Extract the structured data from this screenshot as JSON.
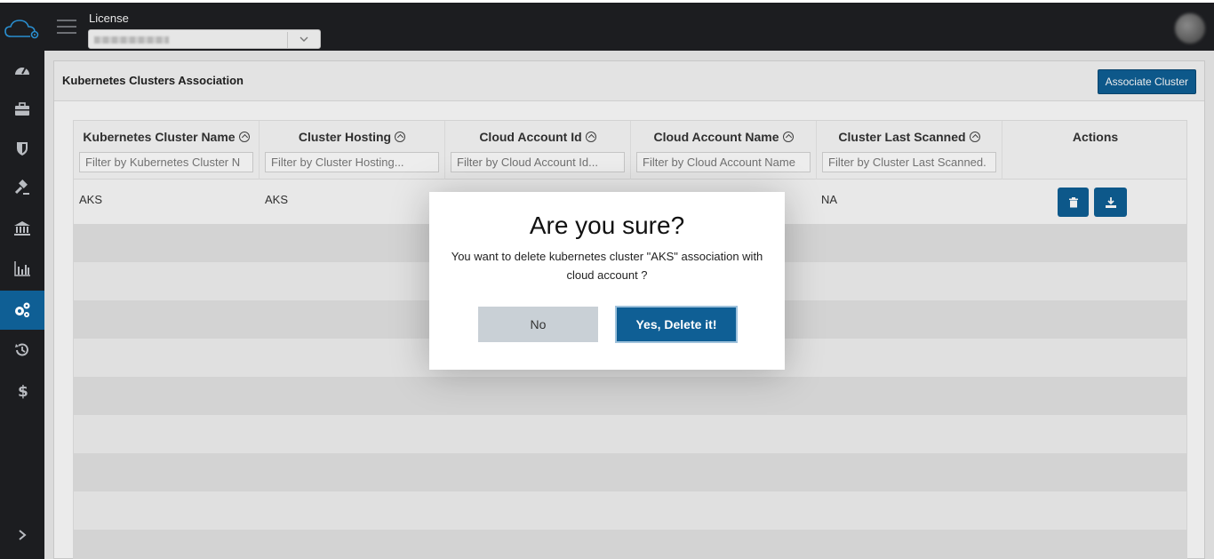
{
  "topbar": {
    "license_label": "License"
  },
  "sidebar": {
    "items": [
      {
        "icon": "dashboard-icon"
      },
      {
        "icon": "briefcase-icon"
      },
      {
        "icon": "shield-icon"
      },
      {
        "icon": "gavel-icon"
      },
      {
        "icon": "bank-icon"
      },
      {
        "icon": "bar-chart-icon"
      },
      {
        "icon": "cogs-icon",
        "active": true
      },
      {
        "icon": "history-icon"
      },
      {
        "icon": "dollar-icon"
      }
    ],
    "expand_icon": "chevron-right-icon"
  },
  "panel": {
    "title": "Kubernetes Clusters Association",
    "associate_button": "Associate Cluster"
  },
  "table": {
    "columns": [
      {
        "label": "Kubernetes Cluster Name",
        "placeholder": "Filter by Kubernetes Cluster N"
      },
      {
        "label": "Cluster Hosting",
        "placeholder": "Filter by Cluster Hosting..."
      },
      {
        "label": "Cloud Account Id",
        "placeholder": "Filter by Cloud Account Id..."
      },
      {
        "label": "Cloud Account Name",
        "placeholder": "Filter by Cloud Account Name"
      },
      {
        "label": "Cluster Last Scanned",
        "placeholder": "Filter by Cluster Last Scanned."
      },
      {
        "label": "Actions",
        "placeholder": ""
      }
    ],
    "rows": [
      {
        "name": "AKS",
        "hosting": "AKS",
        "account_id": "",
        "account_name": "",
        "last_scanned": "NA"
      }
    ]
  },
  "dialog": {
    "title": "Are you sure?",
    "message": "You want to delete kubernetes cluster \"AKS\" association with cloud account ?",
    "cancel_label": "No",
    "confirm_label": "Yes, Delete it!"
  },
  "colors": {
    "primary": "#0f5f95",
    "topbar": "#1c1d20"
  }
}
